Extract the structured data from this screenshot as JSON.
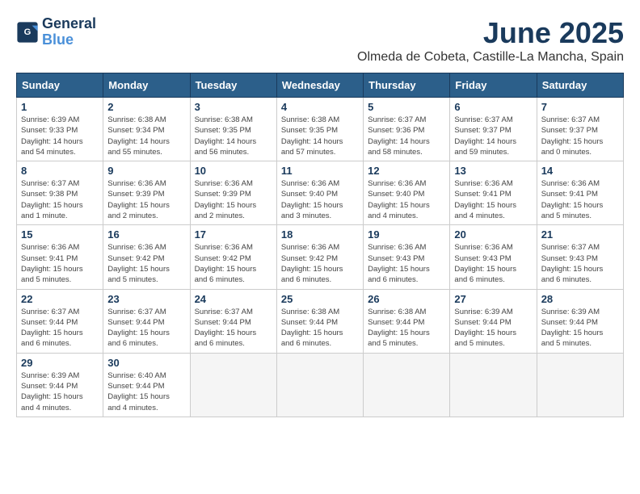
{
  "logo": {
    "text_general": "General",
    "text_blue": "Blue"
  },
  "title": "June 2025",
  "location": "Olmeda de Cobeta, Castille-La Mancha, Spain",
  "days_of_week": [
    "Sunday",
    "Monday",
    "Tuesday",
    "Wednesday",
    "Thursday",
    "Friday",
    "Saturday"
  ],
  "weeks": [
    [
      {
        "day": "1",
        "info": "Sunrise: 6:39 AM\nSunset: 9:33 PM\nDaylight: 14 hours\nand 54 minutes."
      },
      {
        "day": "2",
        "info": "Sunrise: 6:38 AM\nSunset: 9:34 PM\nDaylight: 14 hours\nand 55 minutes."
      },
      {
        "day": "3",
        "info": "Sunrise: 6:38 AM\nSunset: 9:35 PM\nDaylight: 14 hours\nand 56 minutes."
      },
      {
        "day": "4",
        "info": "Sunrise: 6:38 AM\nSunset: 9:35 PM\nDaylight: 14 hours\nand 57 minutes."
      },
      {
        "day": "5",
        "info": "Sunrise: 6:37 AM\nSunset: 9:36 PM\nDaylight: 14 hours\nand 58 minutes."
      },
      {
        "day": "6",
        "info": "Sunrise: 6:37 AM\nSunset: 9:37 PM\nDaylight: 14 hours\nand 59 minutes."
      },
      {
        "day": "7",
        "info": "Sunrise: 6:37 AM\nSunset: 9:37 PM\nDaylight: 15 hours\nand 0 minutes."
      }
    ],
    [
      {
        "day": "8",
        "info": "Sunrise: 6:37 AM\nSunset: 9:38 PM\nDaylight: 15 hours\nand 1 minute."
      },
      {
        "day": "9",
        "info": "Sunrise: 6:36 AM\nSunset: 9:39 PM\nDaylight: 15 hours\nand 2 minutes."
      },
      {
        "day": "10",
        "info": "Sunrise: 6:36 AM\nSunset: 9:39 PM\nDaylight: 15 hours\nand 2 minutes."
      },
      {
        "day": "11",
        "info": "Sunrise: 6:36 AM\nSunset: 9:40 PM\nDaylight: 15 hours\nand 3 minutes."
      },
      {
        "day": "12",
        "info": "Sunrise: 6:36 AM\nSunset: 9:40 PM\nDaylight: 15 hours\nand 4 minutes."
      },
      {
        "day": "13",
        "info": "Sunrise: 6:36 AM\nSunset: 9:41 PM\nDaylight: 15 hours\nand 4 minutes."
      },
      {
        "day": "14",
        "info": "Sunrise: 6:36 AM\nSunset: 9:41 PM\nDaylight: 15 hours\nand 5 minutes."
      }
    ],
    [
      {
        "day": "15",
        "info": "Sunrise: 6:36 AM\nSunset: 9:41 PM\nDaylight: 15 hours\nand 5 minutes."
      },
      {
        "day": "16",
        "info": "Sunrise: 6:36 AM\nSunset: 9:42 PM\nDaylight: 15 hours\nand 5 minutes."
      },
      {
        "day": "17",
        "info": "Sunrise: 6:36 AM\nSunset: 9:42 PM\nDaylight: 15 hours\nand 6 minutes."
      },
      {
        "day": "18",
        "info": "Sunrise: 6:36 AM\nSunset: 9:42 PM\nDaylight: 15 hours\nand 6 minutes."
      },
      {
        "day": "19",
        "info": "Sunrise: 6:36 AM\nSunset: 9:43 PM\nDaylight: 15 hours\nand 6 minutes."
      },
      {
        "day": "20",
        "info": "Sunrise: 6:36 AM\nSunset: 9:43 PM\nDaylight: 15 hours\nand 6 minutes."
      },
      {
        "day": "21",
        "info": "Sunrise: 6:37 AM\nSunset: 9:43 PM\nDaylight: 15 hours\nand 6 minutes."
      }
    ],
    [
      {
        "day": "22",
        "info": "Sunrise: 6:37 AM\nSunset: 9:44 PM\nDaylight: 15 hours\nand 6 minutes."
      },
      {
        "day": "23",
        "info": "Sunrise: 6:37 AM\nSunset: 9:44 PM\nDaylight: 15 hours\nand 6 minutes."
      },
      {
        "day": "24",
        "info": "Sunrise: 6:37 AM\nSunset: 9:44 PM\nDaylight: 15 hours\nand 6 minutes."
      },
      {
        "day": "25",
        "info": "Sunrise: 6:38 AM\nSunset: 9:44 PM\nDaylight: 15 hours\nand 6 minutes."
      },
      {
        "day": "26",
        "info": "Sunrise: 6:38 AM\nSunset: 9:44 PM\nDaylight: 15 hours\nand 5 minutes."
      },
      {
        "day": "27",
        "info": "Sunrise: 6:39 AM\nSunset: 9:44 PM\nDaylight: 15 hours\nand 5 minutes."
      },
      {
        "day": "28",
        "info": "Sunrise: 6:39 AM\nSunset: 9:44 PM\nDaylight: 15 hours\nand 5 minutes."
      }
    ],
    [
      {
        "day": "29",
        "info": "Sunrise: 6:39 AM\nSunset: 9:44 PM\nDaylight: 15 hours\nand 4 minutes."
      },
      {
        "day": "30",
        "info": "Sunrise: 6:40 AM\nSunset: 9:44 PM\nDaylight: 15 hours\nand 4 minutes."
      },
      null,
      null,
      null,
      null,
      null
    ]
  ]
}
